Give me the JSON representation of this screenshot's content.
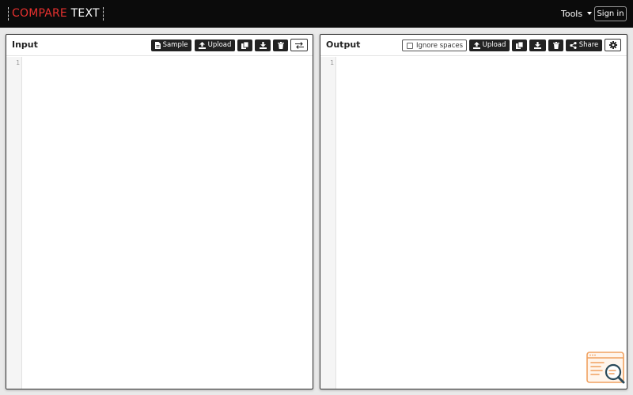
{
  "navbar": {
    "logo_part1": "COMPARE",
    "logo_part2": "TEXT",
    "tools_label": "Tools",
    "signin_label": "Sign in"
  },
  "input_panel": {
    "title": "Input",
    "buttons": {
      "sample": "Sample",
      "upload": "Upload"
    },
    "line_numbers": [
      "1"
    ]
  },
  "output_panel": {
    "title": "Output",
    "ignore_spaces_label": "Ignore spaces",
    "ignore_spaces_checked": false,
    "buttons": {
      "upload": "Upload",
      "share": "Share"
    },
    "line_numbers": [
      "1"
    ]
  },
  "colors": {
    "navbar_bg": "#0b0b0b",
    "logo_accent": "#e8312f",
    "button_bg": "#222222",
    "widget_accent": "#f0a160",
    "widget_dark": "#2b4a5a"
  },
  "icons": {
    "sample": "file-icon",
    "upload": "upload-icon",
    "copy": "copy-icon",
    "download": "download-icon",
    "delete": "trash-icon",
    "swap": "swap-arrows-icon",
    "share": "share-icon",
    "settings": "gear-icon",
    "widget": "search-compare-icon"
  }
}
